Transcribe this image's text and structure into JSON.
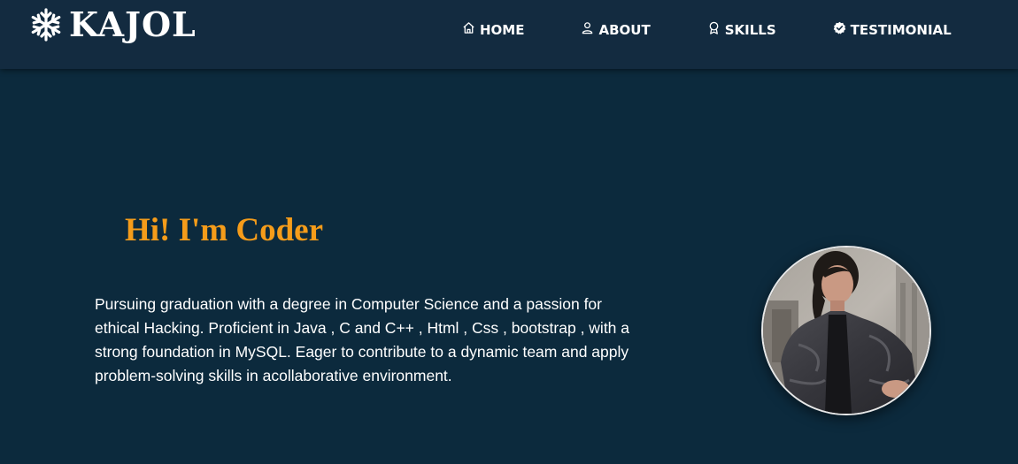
{
  "brand": {
    "icon": "snowflake-icon",
    "name": "KAJOL"
  },
  "nav": {
    "items": [
      {
        "label": "HOME",
        "icon": "home-icon"
      },
      {
        "label": "ABOUT",
        "icon": "user-icon"
      },
      {
        "label": "SKILLS",
        "icon": "award-icon"
      },
      {
        "label": "TESTIMONIAL",
        "icon": "check-badge-icon"
      }
    ]
  },
  "hero": {
    "title": "Hi! I'm Coder",
    "description": "Pursuing graduation with a degree in Computer Science and a passion for ethical Hacking. Proficient in Java , C and C++ , Html , Css , bootstrap , with a strong foundation in MySQL. Eager to contribute to a dynamic team and apply problem-solving skills in acollaborative environment.",
    "photo": "profile-photo"
  },
  "colors": {
    "background": "#0c2a3d",
    "navbar": "#132b40",
    "accent": "#f59c1a",
    "text": "#ffffff"
  }
}
